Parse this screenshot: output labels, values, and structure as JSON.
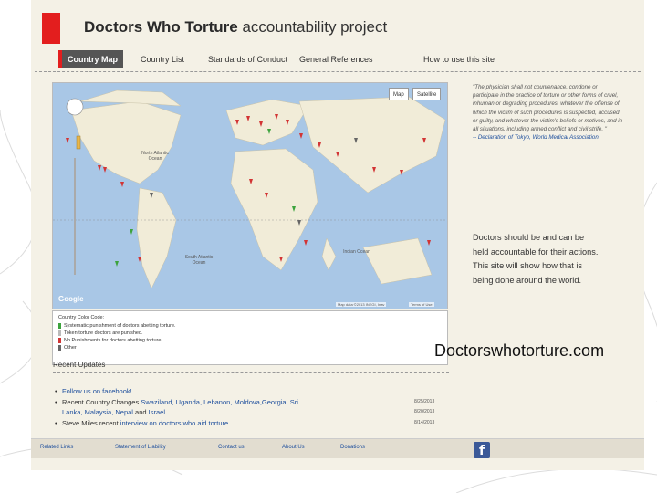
{
  "site": {
    "title_bold": "Doctors Who Torture",
    "title_rest": " accountability project",
    "brand_color": "#e31e1e"
  },
  "nav": {
    "items": [
      "Country Map",
      "Country List",
      "Standards of Conduct",
      "General References",
      "How to use this site"
    ],
    "active": "Country Map"
  },
  "map": {
    "view_buttons": [
      "Map",
      "Satellite"
    ],
    "labels": {
      "north_atlantic": "North Atlantic Ocean",
      "south_atlantic": "South Atlantic Ocean",
      "indian": "Indian Ocean"
    },
    "provider": "Google",
    "footer_data": "Map data ©2013 INEGI, Inav",
    "footer_terms": "Terms of Use"
  },
  "legend": {
    "title": "Country Color Code:",
    "items": [
      {
        "text": "Systematic punishment of doctors abetting torture.",
        "color": "#3da33d"
      },
      {
        "text": "Token torture doctors are punished.",
        "color": "#bbbbbb"
      },
      {
        "text": "No Punishments for doctors abetting torture",
        "color": "#d23434"
      },
      {
        "text": "Other",
        "color": "#666666"
      }
    ]
  },
  "quote": {
    "text": "\"The physician shall not countenance, condone or participate in the practice of torture or other forms of cruel, inhuman or degrading procedures, whatever the offense of which the victim of such procedures is suspected, accused or guilty, and whatever the victim's beliefs or motives, and in all situations, including armed conflict and civil strife. \"",
    "attribution": "-- Declaration of Tokyo, World Medical Association"
  },
  "tagline": "Doctors should be and can be held accountable for their actions. This site will show how that is being done around the world.",
  "recent": {
    "title": "Recent Updates",
    "updates": [
      {
        "prefix": "",
        "link": "Follow us on facebook!",
        "suffix": "",
        "date": ""
      },
      {
        "prefix": "Recent Country Changes ",
        "link": "Swaziland, Uganda, Lebanon, Moldova,Georgia, Sri",
        "suffix": "",
        "date": "8/25/2013"
      },
      {
        "prefix": "",
        "link": "Lanka, Malaysia, Nepal",
        "suffix": " and ",
        "link2": "Israel",
        "date": "8/20/2013",
        "indent": true
      },
      {
        "prefix": "Steve Miles recent ",
        "link": "interview on doctors who aid torture.",
        "suffix": "",
        "date": "8/14/2013"
      }
    ]
  },
  "footer": {
    "links": [
      "Related Links",
      "Statement of Liability",
      "Contact us",
      "About Us",
      "Donations"
    ],
    "facebook_glyph": "f"
  },
  "caption": "Doctorswhotorture.com"
}
